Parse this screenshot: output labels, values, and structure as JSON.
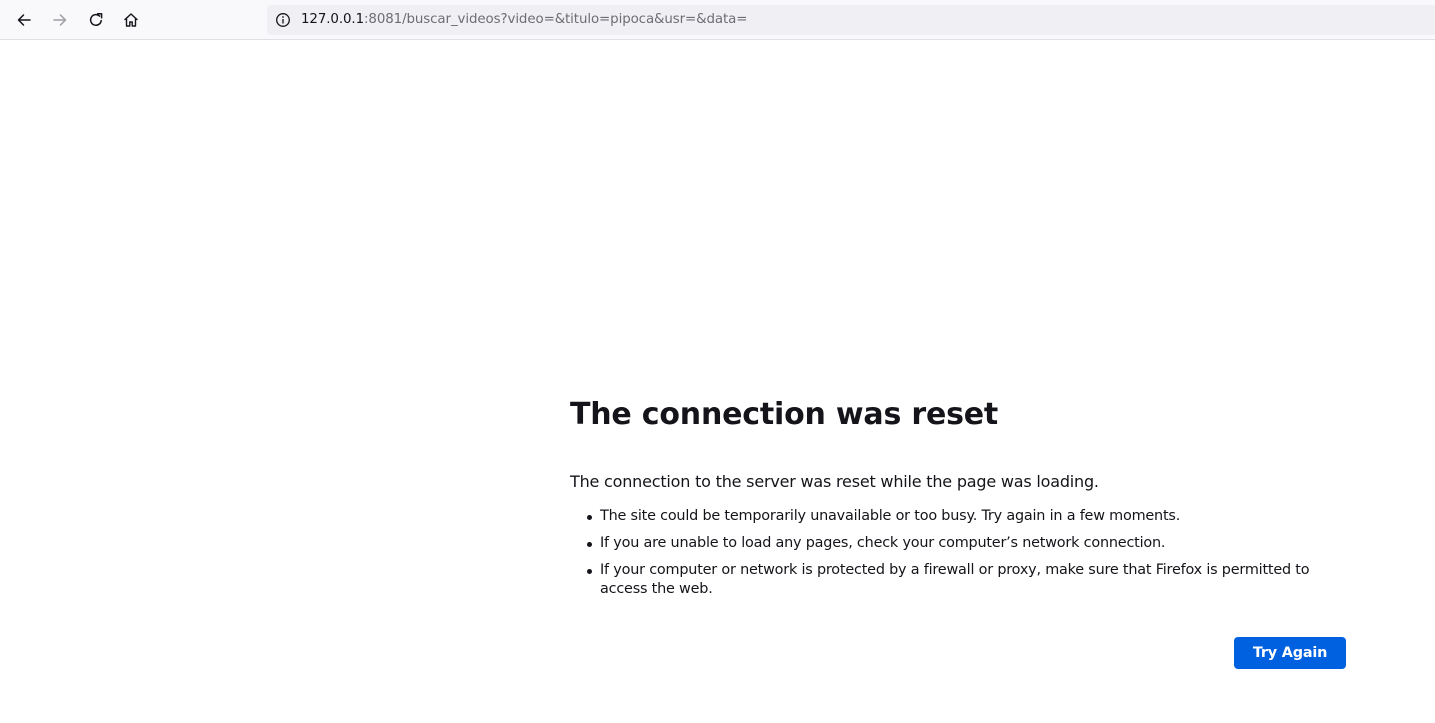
{
  "browser": {
    "url_host": "127.0.0.1",
    "url_rest": ":8081/buscar_videos?video=&titulo=pipoca&usr=&data=",
    "icons": {
      "back": "arrow-left-icon",
      "forward": "arrow-right-icon",
      "reload": "reload-icon",
      "home": "home-icon",
      "site_info": "info-icon"
    }
  },
  "error_page": {
    "title": "The connection was reset",
    "description": "The connection to the server was reset while the page was loading.",
    "suggestions": [
      "The site could be temporarily unavailable or too busy. Try again in a few moments.",
      "If you are unable to load any pages, check your computer’s network connection.",
      "If your computer or network is protected by a firewall or proxy, make sure that Firefox is permitted to access the web."
    ],
    "try_again_label": "Try Again"
  },
  "colors": {
    "accent": "#0061e0",
    "text": "#15141a",
    "url_dim": "#6d6d73",
    "toolbar_bg": "#f9f9fb",
    "urlbar_bg": "#f0f0f4"
  }
}
